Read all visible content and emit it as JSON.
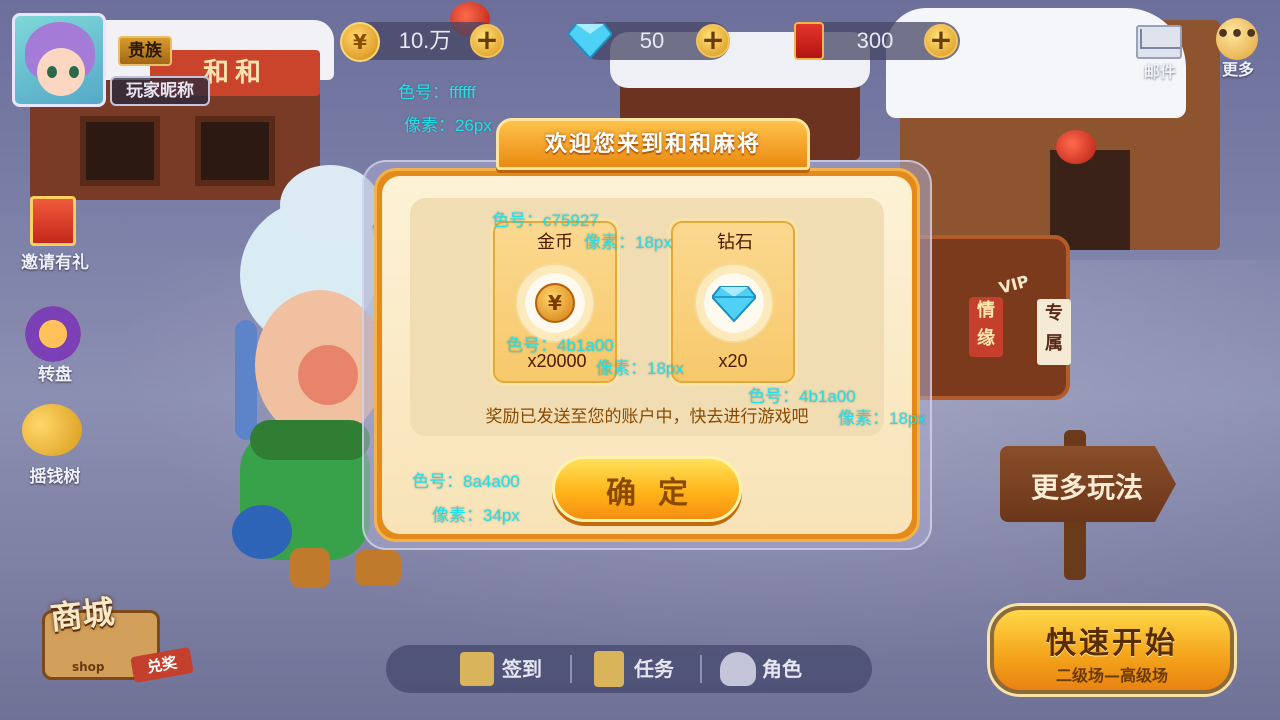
{
  "header": {
    "vip_badge": "贵族",
    "nickname": "玩家昵称",
    "coins": "10.万",
    "gems": "50",
    "red_packets": "300",
    "mail_label": "邮件",
    "more_label": "更多",
    "more_glyph": "•••"
  },
  "sidebar": {
    "items": [
      {
        "label": "邀请有礼",
        "icon": "gift-icon"
      },
      {
        "label": "转盘",
        "icon": "wheel-icon"
      },
      {
        "label": "摇钱树",
        "icon": "money-tree-icon"
      }
    ]
  },
  "scene": {
    "shop_sign": "和和",
    "shop_tag_exclusive": "专属",
    "shop_tag_love": "情缘",
    "vip_sign": "VIP"
  },
  "dialog": {
    "title": "欢迎您来到和和麻将",
    "rewards": [
      {
        "name": "金币",
        "amount": "x20000",
        "icon": "coin-icon"
      },
      {
        "name": "钻石",
        "amount": "x20",
        "icon": "diamond-icon"
      }
    ],
    "message": "奖励已发送至您的账户中，快去进行游戏吧",
    "confirm_label": "确定"
  },
  "annotations": {
    "title_color": "色号：ffffff",
    "title_size": "像素：26px",
    "card_name_color": "色号：c75927",
    "card_name_size": "像素：18px",
    "amount_color": "色号：4b1a00",
    "amount_size": "像素：18px",
    "message_color": "色号：4b1a00",
    "message_size": "像素：18px",
    "button_color": "色号：8a4a00",
    "button_size": "像素：34px"
  },
  "bottom_bar": {
    "sign_in": "签到",
    "tasks": "任务",
    "role": "角色"
  },
  "quick_start": {
    "title": "快速开始",
    "subtitle": "二级场—高级场"
  },
  "more_games": "更多玩法",
  "shop": {
    "title": "商城",
    "redeem": "兑奖",
    "en": "shop"
  },
  "icons": {
    "coin_glyph": "¥"
  },
  "colors": {
    "dialog_title": "#ffffff",
    "card_name": "#c75927",
    "amount": "#4b1a00",
    "message": "#4b1a00",
    "button_text": "#8a4a00"
  }
}
